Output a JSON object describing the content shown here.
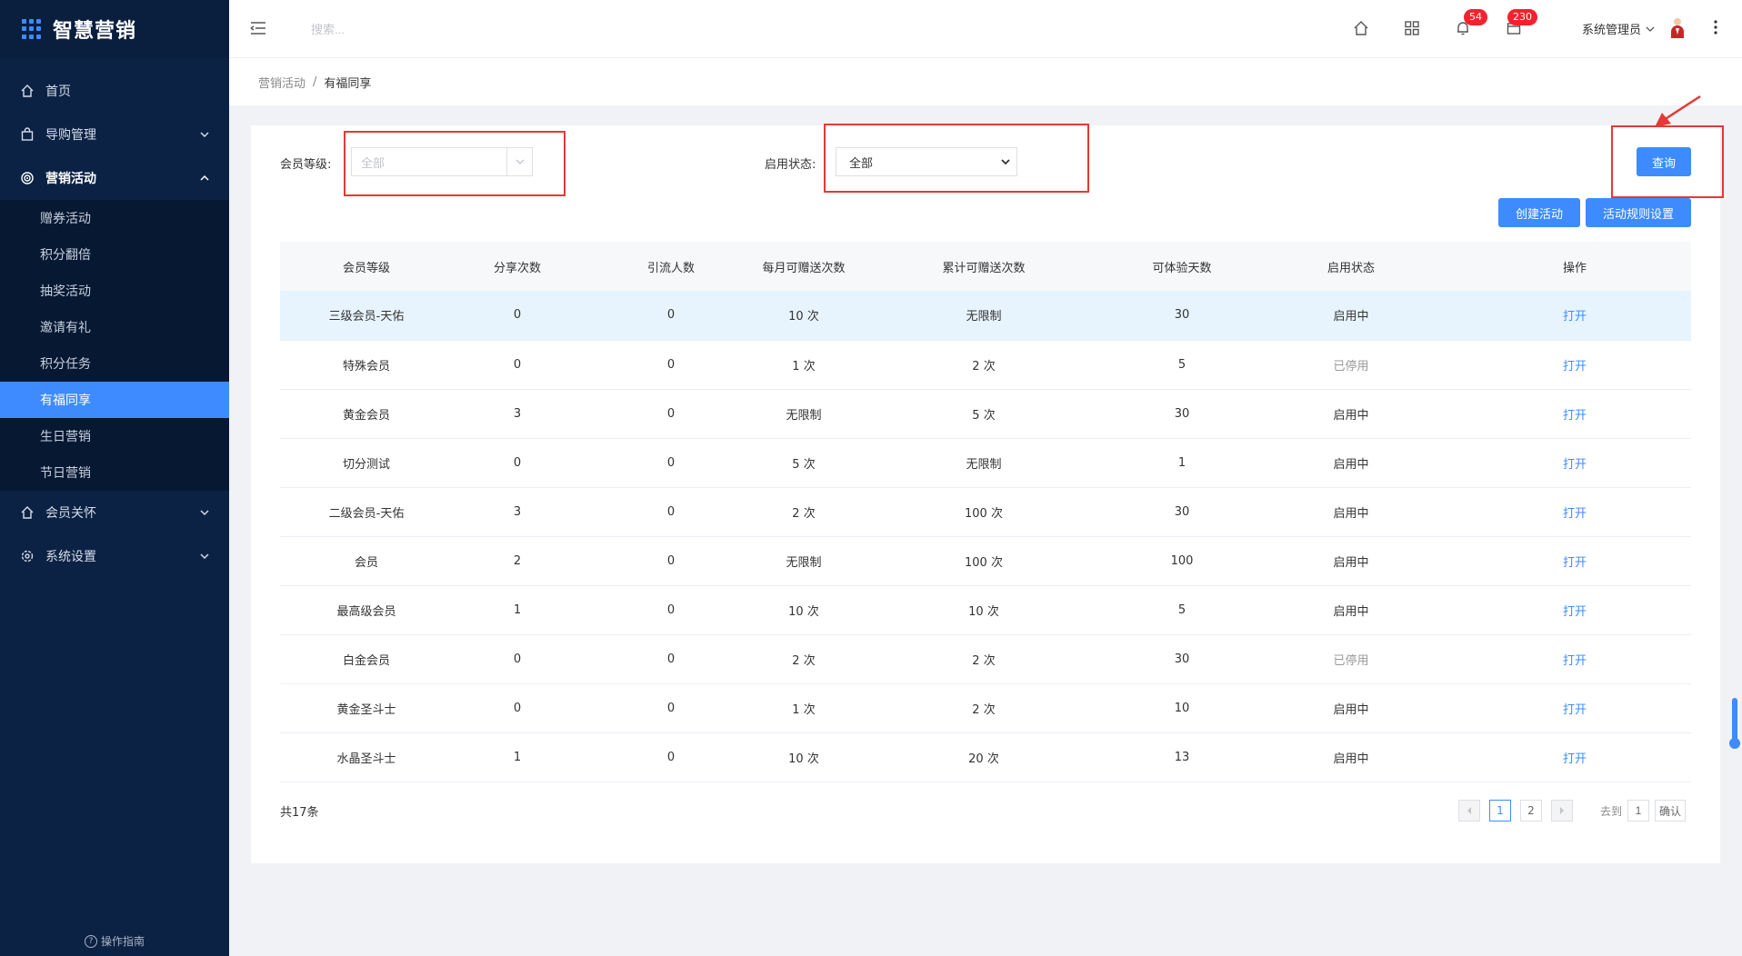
{
  "app": {
    "title": "智慧营销",
    "guide": "操作指南"
  },
  "sidebar": {
    "items": [
      {
        "label": "首页"
      },
      {
        "label": "导购管理"
      },
      {
        "label": "营销活动"
      },
      {
        "label": "会员关怀"
      },
      {
        "label": "系统设置"
      }
    ],
    "marketing_sub": [
      {
        "label": "赠券活动"
      },
      {
        "label": "积分翻倍"
      },
      {
        "label": "抽奖活动"
      },
      {
        "label": "邀请有礼"
      },
      {
        "label": "积分任务"
      },
      {
        "label": "有福同享"
      },
      {
        "label": "生日营销"
      },
      {
        "label": "节日营销"
      }
    ]
  },
  "header": {
    "search_placeholder": "搜索...",
    "notification_count": "54",
    "message_count": "230",
    "user_name": "系统管理员"
  },
  "breadcrumb": {
    "parent": "营销活动",
    "separator": "/",
    "current": "有福同享"
  },
  "filters": {
    "level_label": "会员等级:",
    "level_value": "全部",
    "status_label": "启用状态:",
    "status_value": "全部",
    "query_button": "查询"
  },
  "actions": {
    "create": "创建活动",
    "rules": "活动规则设置"
  },
  "table": {
    "columns": [
      "会员等级",
      "分享次数",
      "引流人数",
      "每月可赠送次数",
      "累计可赠送次数",
      "可体验天数",
      "启用状态",
      "操作"
    ],
    "rows": [
      {
        "level": "三级会员-天佑",
        "shares": "0",
        "referrals": "0",
        "monthly": "10 次",
        "total": "无限制",
        "days": "30",
        "status": "启用中",
        "action": "打开"
      },
      {
        "level": "特殊会员",
        "shares": "0",
        "referrals": "0",
        "monthly": "1 次",
        "total": "2 次",
        "days": "5",
        "status": "已停用",
        "action": "打开"
      },
      {
        "level": "黄金会员",
        "shares": "3",
        "referrals": "0",
        "monthly": "无限制",
        "total": "5 次",
        "days": "30",
        "status": "启用中",
        "action": "打开"
      },
      {
        "level": "切分测试",
        "shares": "0",
        "referrals": "0",
        "monthly": "5 次",
        "total": "无限制",
        "days": "1",
        "status": "启用中",
        "action": "打开"
      },
      {
        "level": "二级会员-天佑",
        "shares": "3",
        "referrals": "0",
        "monthly": "2 次",
        "total": "100 次",
        "days": "30",
        "status": "启用中",
        "action": "打开"
      },
      {
        "level": "会员",
        "shares": "2",
        "referrals": "0",
        "monthly": "无限制",
        "total": "100 次",
        "days": "100",
        "status": "启用中",
        "action": "打开"
      },
      {
        "level": "最高级会员",
        "shares": "1",
        "referrals": "0",
        "monthly": "10 次",
        "total": "10 次",
        "days": "5",
        "status": "启用中",
        "action": "打开"
      },
      {
        "level": "白金会员",
        "shares": "0",
        "referrals": "0",
        "monthly": "2 次",
        "total": "2 次",
        "days": "30",
        "status": "已停用",
        "action": "打开"
      },
      {
        "level": "黄金圣斗士",
        "shares": "0",
        "referrals": "0",
        "monthly": "1 次",
        "total": "2 次",
        "days": "10",
        "status": "启用中",
        "action": "打开"
      },
      {
        "level": "水晶圣斗士",
        "shares": "1",
        "referrals": "0",
        "monthly": "10 次",
        "total": "20 次",
        "days": "13",
        "status": "启用中",
        "action": "打开"
      }
    ]
  },
  "pagination": {
    "total": "共17条",
    "pages": [
      "1",
      "2"
    ],
    "current_page": "1",
    "goto_label": "去到",
    "goto_value": "1",
    "confirm": "确认"
  },
  "colors": {
    "sidebar_bg": "#0c2245",
    "accent": "#3d8bff",
    "highlight_box": "#e53935",
    "badge": "#f5222d"
  }
}
